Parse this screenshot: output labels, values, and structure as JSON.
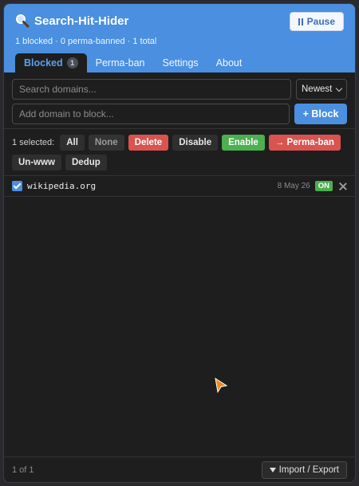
{
  "header": {
    "icon": "magnifier-icon",
    "title": "Search-Hit-Hider",
    "pause_label": "Pause",
    "summary": "1 blocked · 0 perma-banned · 1 total",
    "brand_color": "#4a8fe0"
  },
  "tabs": [
    {
      "label": "Blocked",
      "count": "1",
      "active": true
    },
    {
      "label": "Perma-ban",
      "active": false
    },
    {
      "label": "Settings",
      "active": false
    },
    {
      "label": "About",
      "active": false
    }
  ],
  "search": {
    "placeholder": "Search domains..."
  },
  "sort": {
    "selected": "Newest"
  },
  "add": {
    "placeholder": "Add domain to block...",
    "button_label": "+ Block"
  },
  "bulk": {
    "selected_text": "1 selected:",
    "all": "All",
    "none": "None",
    "delete": "Delete",
    "disable": "Disable",
    "enable": "Enable",
    "perma_ban": "→ Perma-ban",
    "un_www": "Un-www",
    "dedup": "Dedup"
  },
  "items": [
    {
      "domain": "wikipedia.org",
      "date": "8 May 26",
      "status": "ON",
      "checked": true
    }
  ],
  "footer": {
    "pager": "1 of 1",
    "import_export": "Import / Export"
  },
  "colors": {
    "on": "#4caf50",
    "danger": "#d9534f",
    "accent": "#4a8fe0"
  }
}
